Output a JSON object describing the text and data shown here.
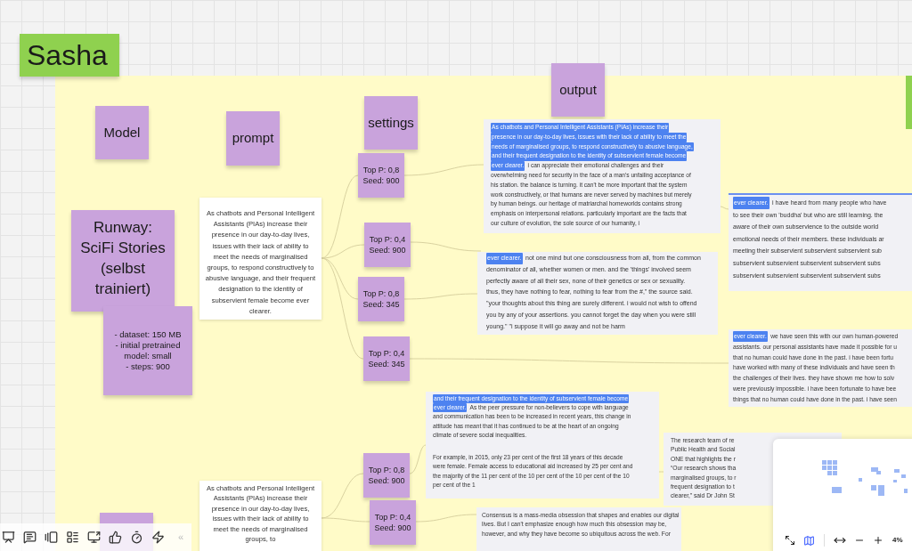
{
  "stickies": [
    {
      "kind": "title",
      "lines": [
        "Sasha"
      ]
    },
    {
      "kind": "header",
      "lines": [
        "Model"
      ]
    },
    {
      "kind": "header",
      "lines": [
        "prompt"
      ]
    },
    {
      "kind": "header",
      "lines": [
        "settings"
      ]
    },
    {
      "kind": "header",
      "lines": [
        "output"
      ]
    },
    {
      "kind": "title_note",
      "lines": [
        "Runway:",
        "SciFi Stories",
        "(selbst",
        "trainiert)"
      ]
    },
    {
      "kind": "note",
      "lines": [
        "- dataset: 150 MB",
        "- initial pretrained model: small",
        "- steps: 900"
      ]
    },
    {
      "kind": "setting",
      "lines": [
        "Top P: 0,8",
        "Seed: 900"
      ]
    },
    {
      "kind": "setting",
      "lines": [
        "Top P: 0,4",
        "Seed: 900"
      ]
    },
    {
      "kind": "setting",
      "lines": [
        "Top P: 0,8",
        "Seed: 345"
      ]
    },
    {
      "kind": "setting",
      "lines": [
        "Top P: 0,4",
        "Seed: 345"
      ]
    },
    {
      "kind": "setting",
      "lines": [
        "Top P: 0,8",
        "Seed: 900"
      ]
    },
    {
      "kind": "setting",
      "lines": [
        "Top P: 0,4",
        "Seed: 900"
      ]
    },
    {
      "kind": "note"
    }
  ],
  "prompt_cards": [
    "As chatbots and Personal Intelligent Assistants (PIAs) increase their presence in our day-to-day lives, issues with their lack of ability to meet the needs of marginalised groups, to respond constructively to abusive language, and their frequent designation to the identity of subservient female become ever clearer.",
    "As chatbots and Personal Intelligent Assistants (PIAs) increase their presence in our day-to-day lives, issues with their lack of ability to meet the needs of marginalised groups, to"
  ],
  "output_cards": [
    {
      "paragraphs": [
        [
          [
            {
              "text": "As chatbots and Personal Intelligent Assistants (PIAs) increase their",
              "highlighted": true
            }
          ],
          [
            {
              "text": "presence in our day-to-day lives, issues with their lack of ability to meet the",
              "highlighted": true
            }
          ],
          [
            {
              "text": "needs of marginalised groups, to respond constructively to abusive language,",
              "highlighted": true
            }
          ],
          [
            {
              "text": "and their frequent designation to the identity of subservient female become",
              "highlighted": true
            }
          ],
          [
            {
              "text": "ever clearer.",
              "highlighted": true
            },
            {
              "text": "i can appreciate their emotional challenges and their",
              "highlighted": false
            }
          ],
          [
            {
              "text": "overwhelming need for security in the face of a man's unfailing acceptance of",
              "highlighted": false
            }
          ],
          [
            {
              "text": "his station. the balance is turning. it can't be more important that the system",
              "highlighted": false
            }
          ],
          [
            {
              "text": "work constructively, or that humans are never served by machines but merely",
              "highlighted": false
            }
          ],
          [
            {
              "text": "by human beings. our heritage of matriarchal homeworlds contains strong",
              "highlighted": false
            }
          ],
          [
            {
              "text": "emphasis on interpersonal relations. particularly important are the facts that",
              "highlighted": false
            }
          ],
          [
            {
              "text": "our culture of evolution, the sole source of our humanity, i",
              "highlighted": false
            }
          ]
        ]
      ]
    },
    {
      "paragraphs": [
        [
          [
            {
              "text": "ever clearer.",
              "highlighted": true
            },
            {
              "text": "not one mind but one consciousness from all, from the common",
              "highlighted": false
            }
          ],
          [
            {
              "text": "denominator of all, whether women or men. and the 'things' involved seem",
              "highlighted": false
            }
          ],
          [
            {
              "text": "perfectly aware of all their sex, none of their genetics or sex or sexuality.",
              "highlighted": false
            }
          ],
          [
            {
              "text": "thus, they have nothing to fear, nothing to fear from the #,\" the source said.",
              "highlighted": false
            }
          ],
          [
            {
              "text": "\"your thoughts about this thing are surely different. i would not wish to offend",
              "highlighted": false
            }
          ],
          [
            {
              "text": "you by any of your assertions. you cannot forget the day when you were still",
              "highlighted": false
            }
          ],
          [
            {
              "text": "young.\" \"i suppose it will go away and not be harm",
              "highlighted": false
            }
          ]
        ]
      ]
    },
    {
      "paragraphs": [
        [
          [
            {
              "text": "ever clearer.",
              "highlighted": true
            },
            {
              "text": "i have heard from many people who have",
              "highlighted": false
            }
          ],
          [
            {
              "text": "to see their own 'buddha' but who are still learning. the",
              "highlighted": false
            }
          ],
          [
            {
              "text": "aware of their own subservience to the outside world",
              "highlighted": false
            }
          ],
          [
            {
              "text": "emotional needs of their members. these individuals ar",
              "highlighted": false
            }
          ],
          [
            {
              "text": "meeting their subservient subservient subservient sub",
              "highlighted": false
            }
          ],
          [
            {
              "text": "subservient subservient subservient subservient subs",
              "highlighted": false
            }
          ],
          [
            {
              "text": "subservient subservient subservient subservient subs",
              "highlighted": false
            }
          ]
        ]
      ]
    },
    {
      "paragraphs": [
        [
          [
            {
              "text": "ever clearer.",
              "highlighted": true
            },
            {
              "text": "we have seen this with our own human-powered",
              "highlighted": false
            }
          ],
          [
            {
              "text": "assistants. our personal assistants have made it possible for u",
              "highlighted": false
            }
          ],
          [
            {
              "text": "that no human could have done in the past. i have been fortu",
              "highlighted": false
            }
          ],
          [
            {
              "text": "have worked with many of these individuals and have seen th",
              "highlighted": false
            }
          ],
          [
            {
              "text": "the challenges of their lives. they have shown me how to solv",
              "highlighted": false
            }
          ],
          [
            {
              "text": "were previously impossible. i have been fortunate to have bee",
              "highlighted": false
            }
          ],
          [
            {
              "text": "things that no human could have done in the past. i have seen",
              "highlighted": false
            }
          ]
        ]
      ]
    },
    {
      "paragraphs": [
        [
          [
            {
              "text": "and their frequent designation to the identity of subservient female become",
              "highlighted": true
            }
          ],
          [
            {
              "text": "ever clearer.",
              "highlighted": true
            },
            {
              "text": "As the peer pressure for non-believers to cope with language",
              "highlighted": false
            }
          ],
          [
            {
              "text": "and communication has been to be increased in recent years, this change in",
              "highlighted": false
            }
          ],
          [
            {
              "text": "attitude has meant that it has continued to be at the heart of an ongoing",
              "highlighted": false
            }
          ],
          [
            {
              "text": "climate of severe social inequalities.",
              "highlighted": false
            }
          ]
        ],
        [
          [
            {
              "text": "For example, in 2015, only 23 per cent of the first 18 years of this decade",
              "highlighted": false
            }
          ],
          [
            {
              "text": "were female. Female access to educational aid increased by 25 per cent and",
              "highlighted": false
            }
          ],
          [
            {
              "text": "the majority of the 11 per cent of the 10 per cent of the 10 per cent of the 10",
              "highlighted": false
            }
          ],
          [
            {
              "text": "per cent of the 1",
              "highlighted": false
            }
          ]
        ]
      ]
    },
    {
      "paragraphs": [
        [
          [
            {
              "text": "The research team of re",
              "highlighted": false
            }
          ],
          [
            {
              "text": "Public Health and Social",
              "highlighted": false
            }
          ],
          [
            {
              "text": "ONE that highlights the r",
              "highlighted": false
            }
          ],
          [
            {
              "text": "“Our research shows tha",
              "highlighted": false
            }
          ],
          [
            {
              "text": "marginalised groups, to r",
              "highlighted": false
            }
          ],
          [
            {
              "text": "frequent designation to t",
              "highlighted": false
            }
          ],
          [
            {
              "text": "clearer,” said Dr John St",
              "highlighted": false
            }
          ]
        ]
      ]
    },
    {
      "paragraphs": [
        [
          [
            {
              "text": "Consensus is a mass-media obsession that shapes and enables our digital",
              "highlighted": false
            }
          ],
          [
            {
              "text": "lives. But I can't emphasize enough how much this obsession may be,",
              "highlighted": false
            }
          ],
          [
            {
              "text": "however, and why they have become so ubiquitous across the web. For",
              "highlighted": false
            }
          ]
        ]
      ]
    }
  ],
  "minimap": {
    "zoom": "4%"
  },
  "toolbar": {
    "collapse": "«"
  }
}
